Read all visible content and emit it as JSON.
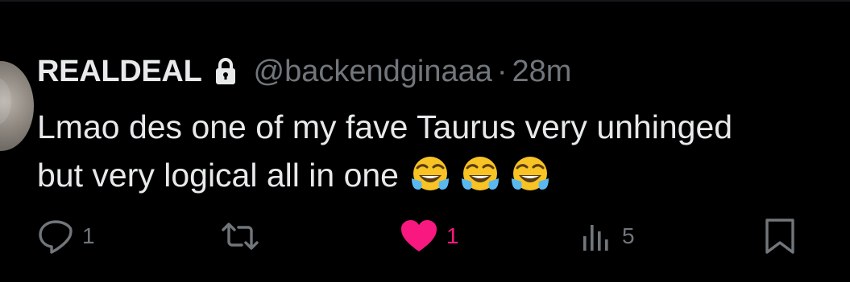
{
  "tweet": {
    "author_name": "REALDEAL",
    "handle": "@backendginaaa",
    "separator": "·",
    "time": "28m",
    "text_line1": "Lmao des one of my fave Taurus very unhinged",
    "text_line2": "but very logical all in one",
    "emojis": [
      "face-with-tears-of-joy",
      "face-with-tears-of-joy",
      "face-with-tears-of-joy"
    ]
  },
  "actions": {
    "reply_count": "1",
    "retweet_count": "",
    "like_count": "1",
    "views_count": "5"
  },
  "colors": {
    "background": "#000000",
    "text_primary": "#e7e9ea",
    "text_secondary": "#71767b",
    "like_pink": "#f91880"
  }
}
